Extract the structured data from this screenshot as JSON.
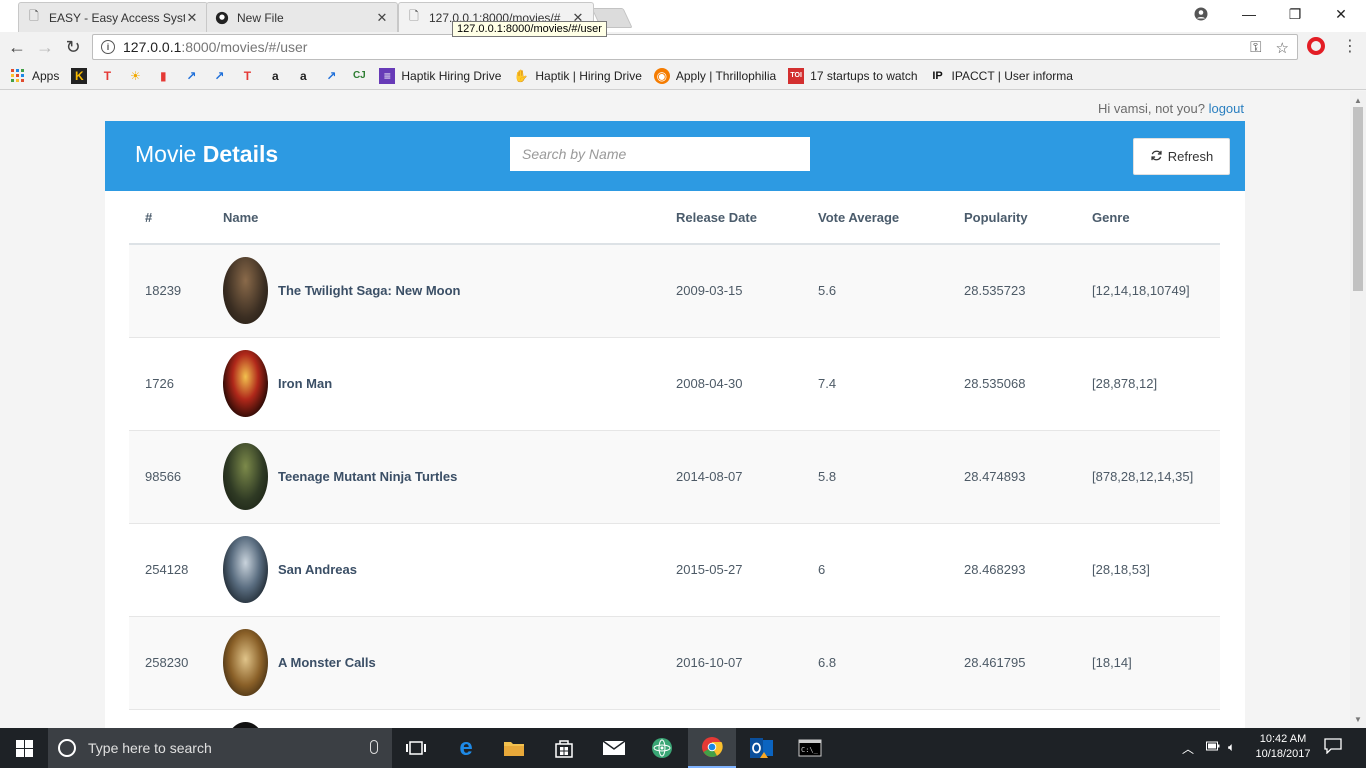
{
  "browser": {
    "tabs": [
      {
        "label": "EASY - Easy Access Syste",
        "icon": "page-icon",
        "active": false
      },
      {
        "label": "New File",
        "icon": "github-icon",
        "active": false
      },
      {
        "label": "127.0.0.1:8000/movies/#",
        "icon": "page-icon",
        "active": true
      }
    ],
    "tooltip": "127.0.0.1:8000/movies/#/user",
    "url_host": "127.0.0.1",
    "url_path": ":8000/movies/#/user",
    "window_controls": {
      "minimize": "—",
      "maximize": "❐",
      "close": "✕"
    },
    "bookmarks": [
      {
        "label": "Apps",
        "icon": "apps-grid-icon",
        "color": "#e04b2e"
      },
      {
        "label": "",
        "icon": "k-icon",
        "glyph": "K",
        "color": "#f5b800"
      },
      {
        "label": "",
        "icon": "t-icon",
        "glyph": "T",
        "color": "#e53935"
      },
      {
        "label": "",
        "icon": "bulb-icon",
        "glyph": "☀",
        "color": "#f2a900"
      },
      {
        "label": "",
        "icon": "bars-icon",
        "glyph": "▮",
        "color": "#e53935"
      },
      {
        "label": "",
        "icon": "trend-icon",
        "glyph": "↗",
        "color": "#1e6fd9"
      },
      {
        "label": "",
        "icon": "trend-icon",
        "glyph": "↗",
        "color": "#1e6fd9"
      },
      {
        "label": "",
        "icon": "t-icon",
        "glyph": "T",
        "color": "#e53935"
      },
      {
        "label": "",
        "icon": "amazon-icon",
        "glyph": "a",
        "color": "#222222"
      },
      {
        "label": "",
        "icon": "amazon-icon",
        "glyph": "a",
        "color": "#222222"
      },
      {
        "label": "",
        "icon": "trend-icon",
        "glyph": "↗",
        "color": "#1e6fd9"
      },
      {
        "label": "",
        "icon": "cj-icon",
        "glyph": "CJ",
        "color": "#2e7d32"
      },
      {
        "label": "Haptik Hiring Drive",
        "icon": "forms-icon",
        "glyph": "≡",
        "color": "#673ab7"
      },
      {
        "label": "Haptik | Hiring Drive",
        "icon": "hand-icon",
        "glyph": "✋",
        "color": "#c58a3a"
      },
      {
        "label": "Apply | Thrillophilia",
        "icon": "thrillophilia-icon",
        "glyph": "◉",
        "color": "#f57c00"
      },
      {
        "label": "17 startups to watch",
        "icon": "toi-icon",
        "glyph": "TOI",
        "color": "#d32f2f"
      },
      {
        "label": "IPACCT | User informa",
        "icon": "ip-icon",
        "glyph": "IP",
        "color": "#111111"
      }
    ]
  },
  "page": {
    "greeting": "Hi vamsi, not you?",
    "logout": "logout",
    "title_light": "Movie",
    "title_bold": "Details",
    "search_placeholder": "Search by Name",
    "refresh_label": "Refresh",
    "accent": "#2d9ae2",
    "columns": [
      "#",
      "Name",
      "Release Date",
      "Vote Average",
      "Popularity",
      "Genre"
    ],
    "movies": [
      {
        "id": "18239",
        "name": "The Twilight Saga: New Moon",
        "release": "2009-03-15",
        "vote": "5.6",
        "popularity": "28.535723",
        "genre": "[12,14,18,10749]",
        "poster": "#3b2e22"
      },
      {
        "id": "1726",
        "name": "Iron Man",
        "release": "2008-04-30",
        "vote": "7.4",
        "popularity": "28.535068",
        "genre": "[28,878,12]",
        "poster": "#4a1a10"
      },
      {
        "id": "98566",
        "name": "Teenage Mutant Ninja Turtles",
        "release": "2014-08-07",
        "vote": "5.8",
        "popularity": "28.474893",
        "genre": "[878,28,12,14,35]",
        "poster": "#2f3a24"
      },
      {
        "id": "254128",
        "name": "San Andreas",
        "release": "2015-05-27",
        "vote": "6",
        "popularity": "28.468293",
        "genre": "[28,18,53]",
        "poster": "#324659"
      },
      {
        "id": "258230",
        "name": "A Monster Calls",
        "release": "2016-10-07",
        "vote": "6.8",
        "popularity": "28.461795",
        "genre": "[18,14]",
        "poster": "#6b4a22"
      },
      {
        "id": "",
        "name": "",
        "release": "",
        "vote": "",
        "popularity": "",
        "genre": "",
        "poster": "#1a1a1a"
      }
    ]
  },
  "taskbar": {
    "search_placeholder": "Type here to search",
    "time": "10:42 AM",
    "date": "10/18/2017"
  }
}
